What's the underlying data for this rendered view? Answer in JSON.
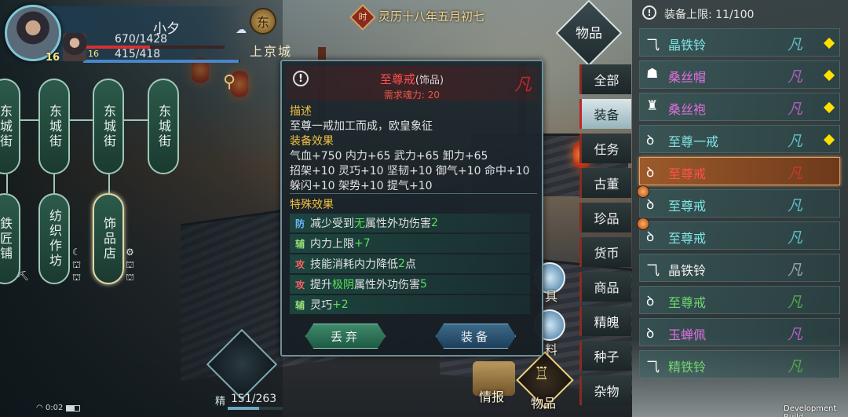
{
  "player": {
    "name": "小夕",
    "level": "16",
    "companion_level": "16",
    "hp": "670/1428",
    "mp": "415/418",
    "hp_fraction": 0.47,
    "mp_fraction": 0.99
  },
  "location": {
    "emblem_char": "东",
    "name": "上京城"
  },
  "date": {
    "badge_char": "时",
    "text": "灵历十八年五月初七"
  },
  "map": {
    "nodes": [
      {
        "label": "东城街"
      },
      {
        "label": "东城街"
      },
      {
        "label": "东城街"
      },
      {
        "label": "东城街"
      },
      {
        "label": "鉄匠铺"
      },
      {
        "label": "纺织作坊"
      },
      {
        "label": "饰品店"
      }
    ]
  },
  "popup": {
    "item_name": "至尊戒",
    "item_type": "(饰品)",
    "requirement": "需求魂力: 20",
    "grade": "凡",
    "desc_title": "描述",
    "desc_text": "至尊一戒加工而成，欧皇象征",
    "effect_title": "装备效果",
    "effect_lines": [
      "气血+750  内力+65  武力+65  卸力+65",
      "招架+10  灵巧+10  坚韧+10  御气+10  命中+10",
      "躲闪+10  架势+10  提气+10"
    ],
    "special_title": "特殊效果",
    "special_effects": [
      {
        "tag": "防",
        "kind": "def",
        "parts": [
          [
            "w",
            "减少受到"
          ],
          [
            "g",
            "无"
          ],
          [
            "w",
            "属性外功伤害"
          ],
          [
            "g",
            "2"
          ]
        ]
      },
      {
        "tag": "辅",
        "kind": "aux",
        "parts": [
          [
            "w",
            "内力上限"
          ],
          [
            "g",
            "+7"
          ]
        ]
      },
      {
        "tag": "攻",
        "kind": "atk",
        "parts": [
          [
            "w",
            "技能消耗内力降低"
          ],
          [
            "g",
            "2"
          ],
          [
            "w",
            "点"
          ]
        ]
      },
      {
        "tag": "攻",
        "kind": "atk",
        "parts": [
          [
            "w",
            "提升"
          ],
          [
            "g",
            "极阴"
          ],
          [
            "w",
            "属性外功伤害"
          ],
          [
            "g",
            "5"
          ]
        ]
      },
      {
        "tag": "辅",
        "kind": "aux",
        "parts": [
          [
            "w",
            "灵巧"
          ],
          [
            "g",
            "+2"
          ]
        ]
      }
    ],
    "discard_label": "丢弃",
    "equip_label": "装备"
  },
  "bottom": {
    "status_time": "0:02",
    "battery_fraction": 0.6,
    "jing_label": "精",
    "jing_value": "151/263",
    "jing_fraction": 0.57,
    "side_label_1": "具",
    "side_label_2": "料",
    "intel_label": "情报",
    "bag_label": "物品"
  },
  "inventory": {
    "header": "物品",
    "limit_text": "装备上限: 11/100",
    "categories": [
      {
        "label": "全部"
      },
      {
        "label": "装备"
      },
      {
        "label": "任务"
      },
      {
        "label": "古董"
      },
      {
        "label": "珍品"
      },
      {
        "label": "货币"
      },
      {
        "label": "商品"
      },
      {
        "label": "精魄"
      },
      {
        "label": "种子"
      },
      {
        "label": "杂物"
      }
    ],
    "active_category": "装备",
    "items": [
      {
        "name": "晶铁铃",
        "icon": "bell-icon",
        "glyph": "⺄",
        "name_color": "#7fe6e6",
        "grade": "凡",
        "grade_color": "#5fbfc8",
        "equipped": true,
        "mark": false
      },
      {
        "name": "桑丝帽",
        "icon": "hat-icon",
        "glyph": "☗",
        "name_color": "#e070e0",
        "grade": "凡",
        "grade_color": "#b060c0",
        "equipped": true,
        "mark": false
      },
      {
        "name": "桑丝袍",
        "icon": "robe-icon",
        "glyph": "♜",
        "name_color": "#e070e0",
        "grade": "凡",
        "grade_color": "#b060c0",
        "equipped": true,
        "mark": false
      },
      {
        "name": "至尊一戒",
        "icon": "ring-icon",
        "glyph": "ꝺ",
        "name_color": "#7fe6e6",
        "grade": "凡",
        "grade_color": "#5fbfc8",
        "equipped": true,
        "mark": false
      },
      {
        "name": "至尊戒",
        "icon": "ring-icon",
        "glyph": "ꝺ",
        "name_color": "#ff5050",
        "grade": "凡",
        "grade_color": "#c83a2a",
        "equipped": false,
        "mark": false,
        "selected": true
      },
      {
        "name": "至尊戒",
        "icon": "ring-icon",
        "glyph": "ꝺ",
        "name_color": "#7fe6e6",
        "grade": "凡",
        "grade_color": "#5fbfc8",
        "equipped": false,
        "mark": true
      },
      {
        "name": "至尊戒",
        "icon": "ring-icon",
        "glyph": "ꝺ",
        "name_color": "#7fe6e6",
        "grade": "凡",
        "grade_color": "#5fbfc8",
        "equipped": false,
        "mark": true
      },
      {
        "name": "晶铁铃",
        "icon": "bell-icon",
        "glyph": "⺄",
        "name_color": "#f0f0f0",
        "grade": "凡",
        "grade_color": "#9aa6a6",
        "equipped": false,
        "mark": false
      },
      {
        "name": "至尊戒",
        "icon": "ring-icon",
        "glyph": "ꝺ",
        "name_color": "#6fd86f",
        "grade": "凡",
        "grade_color": "#4fa84f",
        "equipped": false,
        "mark": false
      },
      {
        "name": "玉蝉佩",
        "icon": "pendant-icon",
        "glyph": "ꝺ",
        "name_color": "#e070e0",
        "grade": "凡",
        "grade_color": "#b060c0",
        "equipped": false,
        "mark": false
      },
      {
        "name": "精铁铃",
        "icon": "bell-icon",
        "glyph": "⺄",
        "name_color": "#6fd86f",
        "grade": "凡",
        "grade_color": "#4fa84f",
        "equipped": false,
        "mark": false
      }
    ]
  },
  "footer": {
    "build": "Development Build"
  },
  "colors": {
    "accent_red": "#ff4f4f",
    "gold": "#f0c040",
    "equipped_marker": "#ffe000"
  }
}
